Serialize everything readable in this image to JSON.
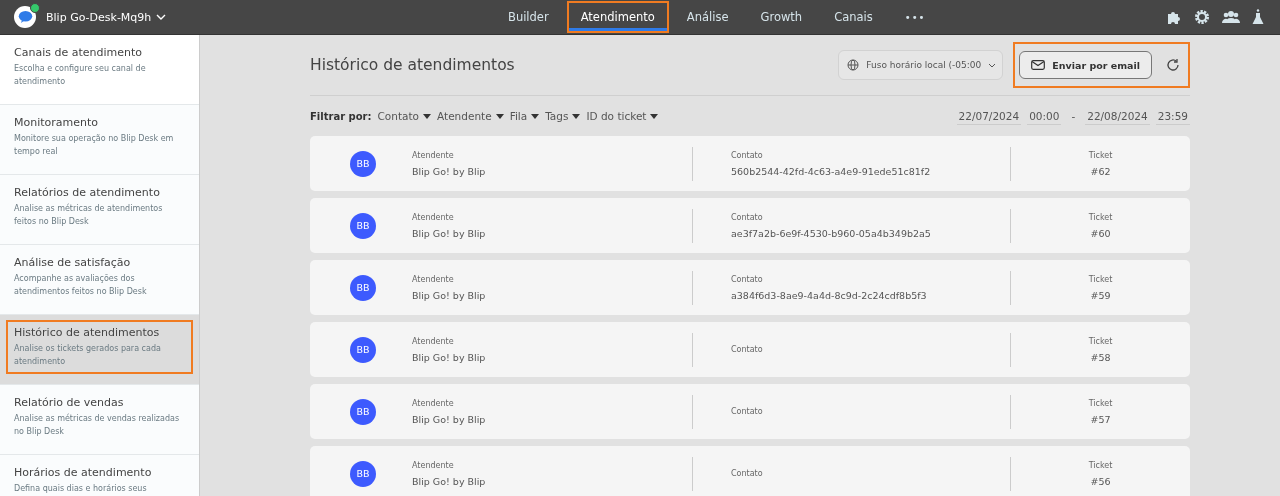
{
  "topbar": {
    "workspace": "Blip Go-Desk-Mq9h",
    "online": true,
    "tabs": [
      {
        "label": "Builder",
        "selected": false,
        "highlighted": false
      },
      {
        "label": "Atendimento",
        "selected": true,
        "highlighted": true
      },
      {
        "label": "Análise",
        "selected": false,
        "highlighted": false
      },
      {
        "label": "Growth",
        "selected": false,
        "highlighted": false
      },
      {
        "label": "Canais",
        "selected": false,
        "highlighted": false
      }
    ],
    "more": "•••"
  },
  "sidebar": {
    "items": [
      {
        "title": "Canais de atendimento",
        "description": "Escolha e configure seu canal de atendimento",
        "selected": false,
        "highlighted": false
      },
      {
        "title": "Monitoramento",
        "description": "Monitore sua operação no Blip Desk em tempo real",
        "selected": false,
        "highlighted": false
      },
      {
        "title": "Relatórios de atendimento",
        "description": "Analise as métricas de atendimentos feitos no Blip Desk",
        "selected": false,
        "highlighted": false
      },
      {
        "title": "Análise de satisfação",
        "description": "Acompanhe as avaliações dos atendimentos feitos no Blip Desk",
        "selected": false,
        "highlighted": false
      },
      {
        "title": "Histórico de atendimentos",
        "description": "Analise os tickets gerados para cada atendimento",
        "selected": true,
        "highlighted": true
      },
      {
        "title": "Relatório de vendas",
        "description": "Analise as métricas de vendas realizadas no Blip Desk",
        "selected": false,
        "highlighted": false
      },
      {
        "title": "Horários de atendimento",
        "description": "Defina quais dias e horários seus",
        "selected": false,
        "highlighted": false
      }
    ]
  },
  "page": {
    "title": "Histórico de atendimentos",
    "timezone": "Fuso horário local (-05:00",
    "email_button": {
      "label": "Enviar por email",
      "highlighted": true
    },
    "filter_label": "Filtrar por:",
    "filters": [
      "Contato",
      "Atendente",
      "Fila",
      "Tags",
      "ID do ticket"
    ],
    "date_from": "22/07/2024",
    "time_from": "00:00",
    "date_separator": "-",
    "date_to": "22/08/2024",
    "time_to": "23:59"
  },
  "tickets": [
    {
      "initials": "BB",
      "agent_label": "Atendente",
      "agent": "Blip Go! by Blip",
      "contact_label": "Contato",
      "contact": "560b2544-42fd-4c63-a4e9-91ede51c81f2",
      "ticket_label": "Ticket",
      "ticket": "#62"
    },
    {
      "initials": "BB",
      "agent_label": "Atendente",
      "agent": "Blip Go! by Blip",
      "contact_label": "Contato",
      "contact": "ae3f7a2b-6e9f-4530-b960-05a4b349b2a5",
      "ticket_label": "Ticket",
      "ticket": "#60"
    },
    {
      "initials": "BB",
      "agent_label": "Atendente",
      "agent": "Blip Go! by Blip",
      "contact_label": "Contato",
      "contact": "a384f6d3-8ae9-4a4d-8c9d-2c24cdf8b5f3",
      "ticket_label": "Ticket",
      "ticket": "#59"
    },
    {
      "initials": "BB",
      "agent_label": "Atendente",
      "agent": "Blip Go! by Blip",
      "contact_label": "Contato",
      "ticket_label": "Ticket",
      "ticket": "#58"
    },
    {
      "initials": "BB",
      "agent_label": "Atendente",
      "agent": "Blip Go! by Blip",
      "contact_label": "Contato",
      "ticket_label": "Ticket",
      "ticket": "#57"
    },
    {
      "initials": "BB",
      "agent_label": "Atendente",
      "agent": "Blip Go! by Blip",
      "contact_label": "Contato",
      "ticket_label": "Ticket",
      "ticket": "#56"
    }
  ]
}
